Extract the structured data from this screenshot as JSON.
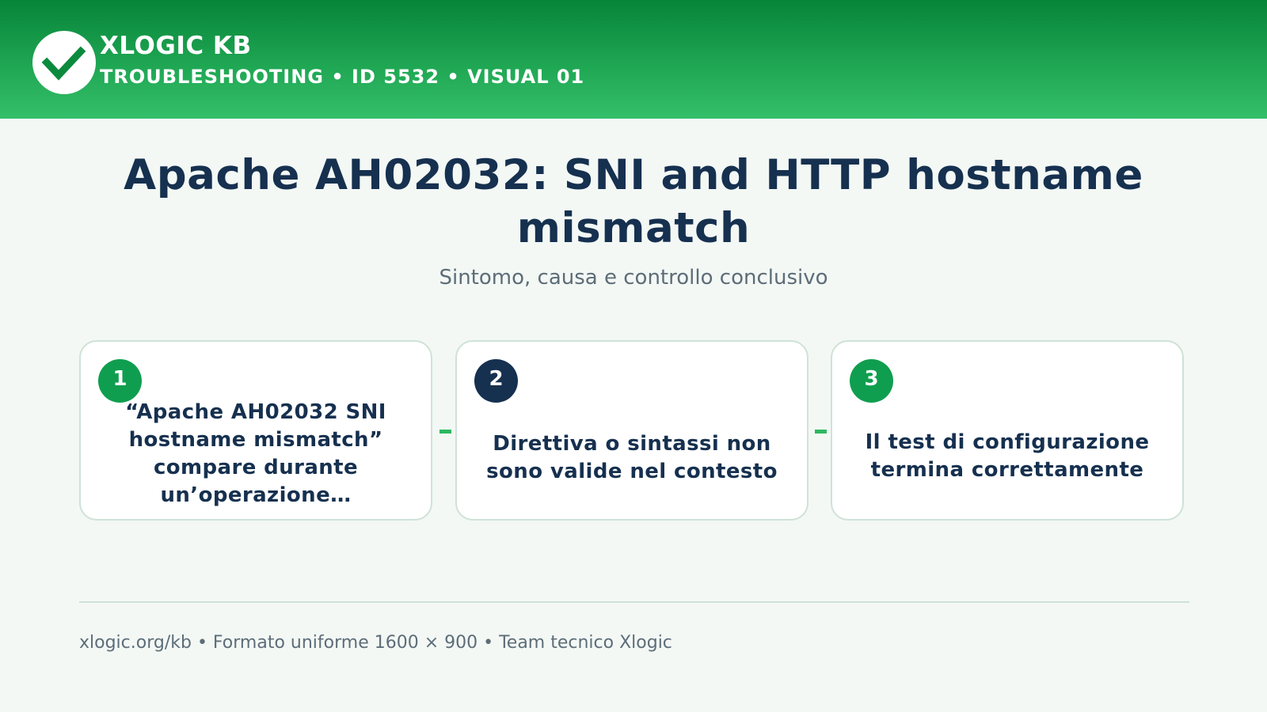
{
  "header": {
    "brand_title": "XLOGIC KB",
    "brand_subtitle": "TROUBLESHOOTING • ID 5532 • VISUAL 01",
    "logo_icon": "check-circle-icon",
    "background": "#0b8a3e"
  },
  "main": {
    "title": "Apache AH02032: SNI and HTTP hostname mismatch",
    "subtitle": "Sintomo, causa e controllo conclusivo"
  },
  "steps": [
    {
      "number": "1",
      "text": "“Apache AH02032 SNI hostname mismatch” compare durante un’operazione…",
      "badge_color": "#0f9e4f"
    },
    {
      "number": "2",
      "text": "Direttiva o sintassi non sono valide nel contesto",
      "badge_color": "#16304f"
    },
    {
      "number": "3",
      "text": "Il test di configurazione termina correttamente",
      "badge_color": "#0f9e4f"
    }
  ],
  "footer": {
    "text": "xlogic.org/kb • Formato uniforme 1600 × 900 • Team tecnico Xlogic"
  },
  "colors": {
    "accent_green": "#0f9e4f",
    "navy": "#16304f",
    "connector": "#2db862"
  }
}
